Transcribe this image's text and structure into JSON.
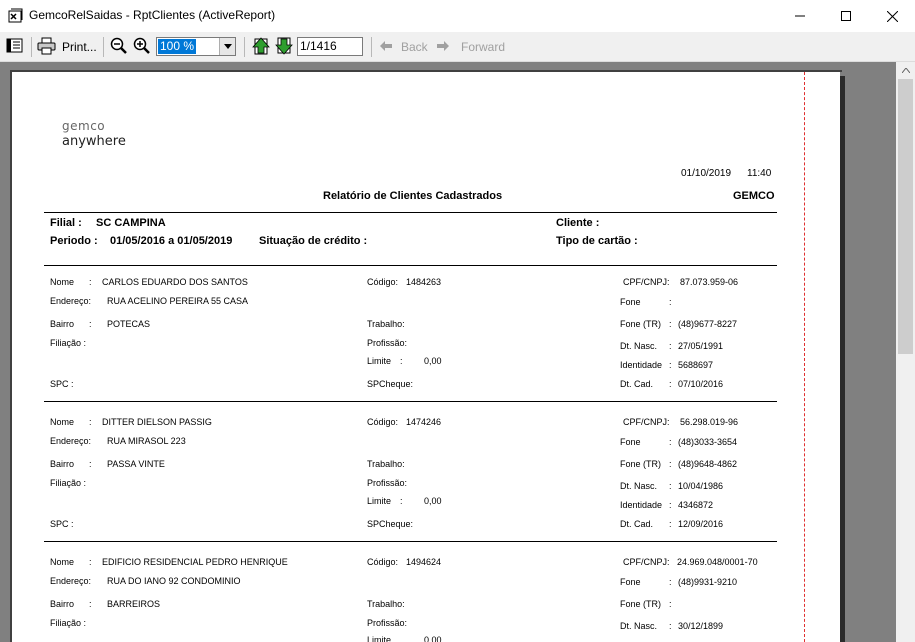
{
  "window": {
    "title": "GemcoRelSaidas - RptClientes (ActiveReport)"
  },
  "toolbar": {
    "print_label": "Print...",
    "zoom_value": "100 %",
    "page_value": "1/1416",
    "back_label": "Back",
    "forward_label": "Forward"
  },
  "report": {
    "logo_line1": "gemco",
    "logo_line2": "anywhere",
    "date": "01/10/2019",
    "time": "11:40",
    "title": "Relatório de Clientes Cadastrados",
    "company": "GEMCO",
    "filial_label": "Filial :",
    "filial_value": "SC CAMPINA",
    "periodo_label": "Periodo :",
    "periodo_value": "01/05/2016  a 01/05/2019",
    "situacao_label": "Situação de crédito :",
    "cliente_label": "Cliente :",
    "tipo_cartao_label": "Tipo de cartão :",
    "labels": {
      "nome": "Nome",
      "endereco": "Endereço:",
      "bairro": "Bairro",
      "filiacao": "Filiação :",
      "spc": "SPC :",
      "codigo": "Código:",
      "trabalho": "Trabalho:",
      "profissao": "Profissão:",
      "limite": "Limite",
      "spcheque": "SPCheque:",
      "cpf": "CPF/CNPJ:",
      "fone": "Fone",
      "fone_tr": "Fone (TR)",
      "dt_nasc": "Dt. Nasc.",
      "identidade": "Identidade",
      "dt_cad": "Dt. Cad."
    },
    "records": [
      {
        "nome": "CARLOS EDUARDO DOS SANTOS",
        "endereco": "RUA ACELINO PEREIRA 55 CASA",
        "bairro": "POTECAS",
        "codigo": "1484263",
        "limite": "0,00",
        "cpf": "87.073.959-06",
        "fone": "",
        "fone_tr": "(48)9677-8227",
        "dt_nasc": "27/05/1991",
        "identidade": "5688697",
        "dt_cad": "07/10/2016"
      },
      {
        "nome": "DITTER DIELSON PASSIG",
        "endereco": "RUA MIRASOL 223",
        "bairro": "PASSA VINTE",
        "codigo": "1474246",
        "limite": "0,00",
        "cpf": "56.298.019-96",
        "fone": "(48)3033-3654",
        "fone_tr": "(48)9648-4862",
        "dt_nasc": "10/04/1986",
        "identidade": "4346872",
        "dt_cad": "12/09/2016"
      },
      {
        "nome": "EDIFICIO RESIDENCIAL PEDRO HENRIQUE",
        "endereco": "RUA DO IANO 92 CONDOMINIO",
        "bairro": "BARREIROS",
        "codigo": "1494624",
        "limite": "0,00",
        "cpf": "24.969.048/0001-70",
        "fone": "(48)9931-9210",
        "fone_tr": "",
        "dt_nasc": "30/12/1899",
        "identidade": "",
        "dt_cad": ""
      }
    ]
  }
}
